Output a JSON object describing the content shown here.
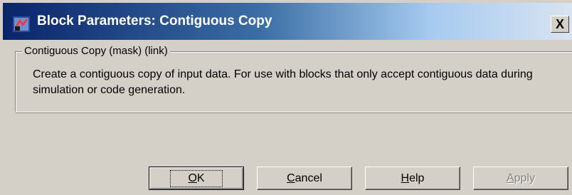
{
  "window": {
    "title": "Block Parameters: Contiguous Copy",
    "close_label": "X"
  },
  "group": {
    "legend": "Contiguous Copy (mask) (link)",
    "description": "Create a contiguous copy of input data.  For use with blocks that only accept contiguous data during simulation or code generation."
  },
  "buttons": {
    "ok": {
      "accel": "O",
      "rest": "K"
    },
    "cancel": {
      "accel": "C",
      "rest": "ancel"
    },
    "help": {
      "accel": "H",
      "rest": "elp"
    },
    "apply": {
      "accel": "A",
      "rest": "pply",
      "enabled": false
    }
  },
  "icons": {
    "app": "simulink-block-icon",
    "close": "close-icon"
  },
  "colors": {
    "titlebar_start": "#0a246a",
    "titlebar_end": "#d8e4f0",
    "face": "#d4d0c8"
  }
}
